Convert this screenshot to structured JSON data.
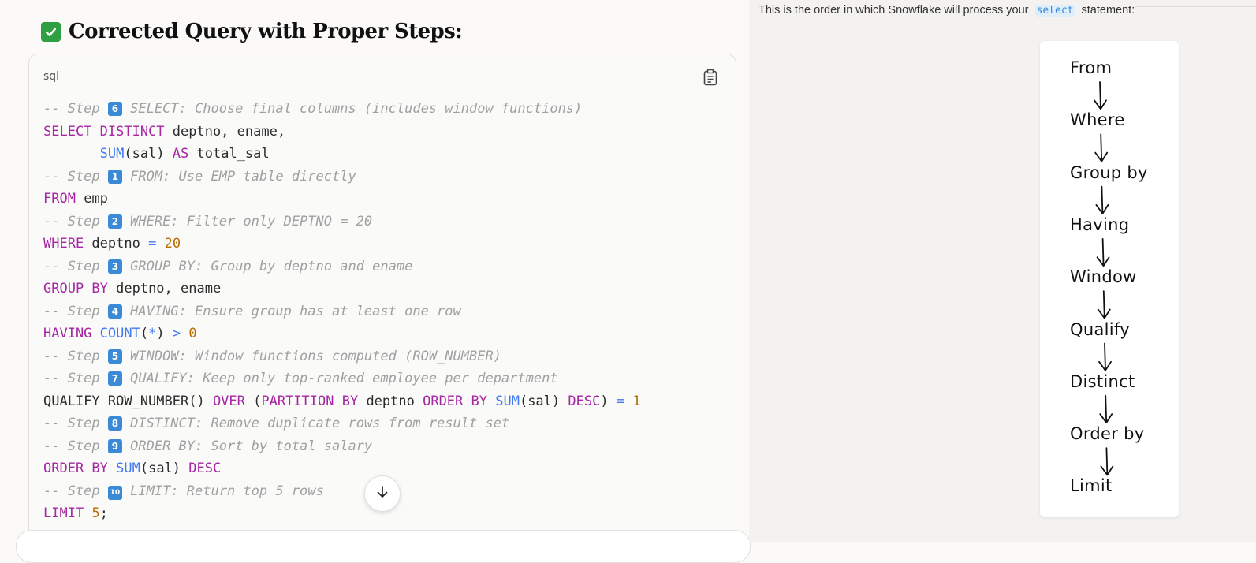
{
  "heading": {
    "title": "Corrected Query with Proper Steps:"
  },
  "code": {
    "language": "sql",
    "lines": [
      [
        {
          "t": "c",
          "v": "-- Step "
        },
        {
          "t": "e",
          "v": "6"
        },
        {
          "t": "c",
          "v": " SELECT: Choose final columns (includes window functions)"
        }
      ],
      [
        {
          "t": "k",
          "v": "SELECT DISTINCT"
        },
        {
          "t": "p",
          "v": " deptno, ename,"
        }
      ],
      [
        {
          "t": "p",
          "v": "       "
        },
        {
          "t": "f",
          "v": "SUM"
        },
        {
          "t": "p",
          "v": "(sal) "
        },
        {
          "t": "k",
          "v": "AS"
        },
        {
          "t": "p",
          "v": " total_sal"
        }
      ],
      [
        {
          "t": "c",
          "v": "-- Step "
        },
        {
          "t": "e",
          "v": "1"
        },
        {
          "t": "c",
          "v": " FROM: Use EMP table directly"
        }
      ],
      [
        {
          "t": "k",
          "v": "FROM"
        },
        {
          "t": "p",
          "v": " emp"
        }
      ],
      [
        {
          "t": "c",
          "v": "-- Step "
        },
        {
          "t": "e",
          "v": "2"
        },
        {
          "t": "c",
          "v": " WHERE: Filter only DEPTNO = 20"
        }
      ],
      [
        {
          "t": "k",
          "v": "WHERE"
        },
        {
          "t": "p",
          "v": " deptno "
        },
        {
          "t": "o",
          "v": "="
        },
        {
          "t": "p",
          "v": " "
        },
        {
          "t": "n",
          "v": "20"
        }
      ],
      [
        {
          "t": "c",
          "v": "-- Step "
        },
        {
          "t": "e",
          "v": "3"
        },
        {
          "t": "c",
          "v": " GROUP BY: Group by deptno and ename"
        }
      ],
      [
        {
          "t": "k",
          "v": "GROUP BY"
        },
        {
          "t": "p",
          "v": " deptno, ename"
        }
      ],
      [
        {
          "t": "c",
          "v": "-- Step "
        },
        {
          "t": "e",
          "v": "4"
        },
        {
          "t": "c",
          "v": " HAVING: Ensure group has at least one row"
        }
      ],
      [
        {
          "t": "k",
          "v": "HAVING"
        },
        {
          "t": "p",
          "v": " "
        },
        {
          "t": "f",
          "v": "COUNT"
        },
        {
          "t": "p",
          "v": "("
        },
        {
          "t": "o",
          "v": "*"
        },
        {
          "t": "p",
          "v": ") "
        },
        {
          "t": "o",
          "v": ">"
        },
        {
          "t": "p",
          "v": " "
        },
        {
          "t": "n",
          "v": "0"
        }
      ],
      [
        {
          "t": "c",
          "v": "-- Step "
        },
        {
          "t": "e",
          "v": "5"
        },
        {
          "t": "c",
          "v": " WINDOW: Window functions computed (ROW_NUMBER)"
        }
      ],
      [
        {
          "t": "c",
          "v": "-- Step "
        },
        {
          "t": "e",
          "v": "7"
        },
        {
          "t": "c",
          "v": " QUALIFY: Keep only top-ranked employee per department"
        }
      ],
      [
        {
          "t": "p",
          "v": "QUALIFY ROW_NUMBER() "
        },
        {
          "t": "k",
          "v": "OVER"
        },
        {
          "t": "p",
          "v": " ("
        },
        {
          "t": "k",
          "v": "PARTITION BY"
        },
        {
          "t": "p",
          "v": " deptno "
        },
        {
          "t": "k",
          "v": "ORDER BY"
        },
        {
          "t": "p",
          "v": " "
        },
        {
          "t": "f",
          "v": "SUM"
        },
        {
          "t": "p",
          "v": "(sal) "
        },
        {
          "t": "k",
          "v": "DESC"
        },
        {
          "t": "p",
          "v": ") "
        },
        {
          "t": "o",
          "v": "="
        },
        {
          "t": "p",
          "v": " "
        },
        {
          "t": "n",
          "v": "1"
        }
      ],
      [
        {
          "t": "c",
          "v": "-- Step "
        },
        {
          "t": "e",
          "v": "8"
        },
        {
          "t": "c",
          "v": " DISTINCT: Remove duplicate rows from result set"
        }
      ],
      [
        {
          "t": "c",
          "v": "-- Step "
        },
        {
          "t": "e",
          "v": "9"
        },
        {
          "t": "c",
          "v": " ORDER BY: Sort by total salary"
        }
      ],
      [
        {
          "t": "k",
          "v": "ORDER BY"
        },
        {
          "t": "p",
          "v": " "
        },
        {
          "t": "f",
          "v": "SUM"
        },
        {
          "t": "p",
          "v": "(sal) "
        },
        {
          "t": "k",
          "v": "DESC"
        }
      ],
      [
        {
          "t": "c",
          "v": "-- Step "
        },
        {
          "t": "e",
          "v": "10"
        },
        {
          "t": "c",
          "v": " LIMIT: Return top 5 rows"
        }
      ],
      [
        {
          "t": "k",
          "v": "LIMIT"
        },
        {
          "t": "p",
          "v": " "
        },
        {
          "t": "n",
          "v": "5"
        },
        {
          "t": "p",
          "v": ";"
        }
      ]
    ]
  },
  "icons": {
    "heading": "check-mark-icon",
    "copy": "clipboard-icon",
    "scroll": "arrow-down-icon"
  },
  "right": {
    "intro_before": "This is the order in which Snowflake will process your ",
    "intro_code": "select",
    "intro_after": " statement:",
    "steps": [
      "From",
      "Where",
      "Group by",
      "Having",
      "Window",
      "Qualify",
      "Distinct",
      "Order by",
      "Limit"
    ]
  },
  "colors": {
    "keyword": "#a626a4",
    "function": "#4078f2",
    "number": "#b76b01",
    "comment": "#a0a0a0",
    "check": "#2ea043"
  }
}
